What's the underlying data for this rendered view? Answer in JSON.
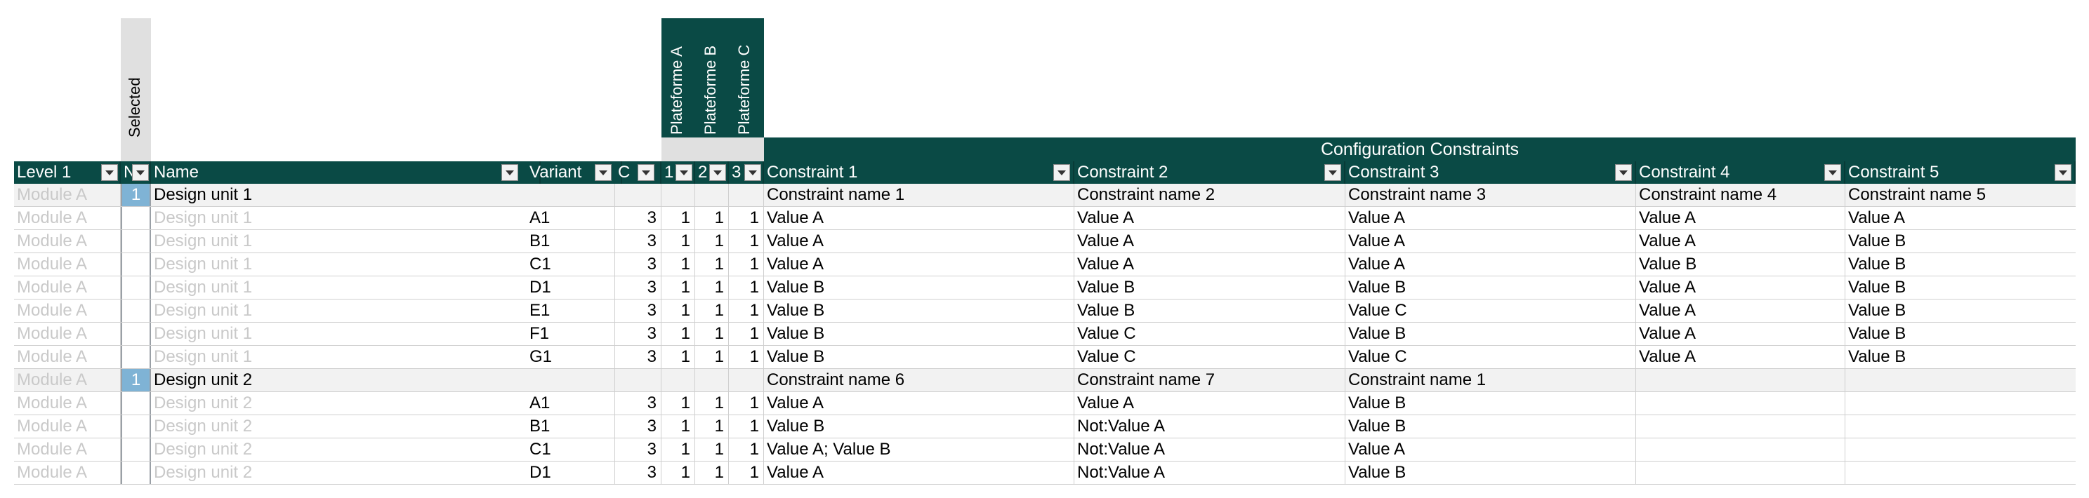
{
  "header": {
    "selected_label": "Selected",
    "platforms": [
      "Plateforme A",
      "Plateforme B",
      "Plateforme C"
    ],
    "config_group": "Configuration Constraints",
    "columns": {
      "level1": "Level 1",
      "n": "N",
      "name": "Name",
      "variant": "Variant",
      "c": "C",
      "p1": "1",
      "p2": "2",
      "p3": "3",
      "cons1": "Constraint 1",
      "cons2": "Constraint 2",
      "cons3": "Constraint 3",
      "cons4": "Constraint 4",
      "cons5": "Constraint 5"
    }
  },
  "rows": [
    {
      "type": "group",
      "level": "Module A",
      "sel": "1",
      "name": "Design unit 1",
      "variant": "",
      "c": "",
      "p1": "",
      "p2": "",
      "p3": "",
      "c1": "Constraint name 1",
      "c2": "Constraint name 2",
      "c3": "Constraint name 3",
      "c4": "Constraint name 4",
      "c5": "Constraint name 5"
    },
    {
      "type": "item",
      "level": "Module A",
      "sel": "",
      "name": "Design unit 1",
      "variant": "A1",
      "c": "3",
      "p1": "1",
      "p2": "1",
      "p3": "1",
      "c1": "Value A",
      "c2": "Value A",
      "c3": "Value A",
      "c4": "Value A",
      "c5": "Value A"
    },
    {
      "type": "item",
      "level": "Module A",
      "sel": "",
      "name": "Design unit 1",
      "variant": "B1",
      "c": "3",
      "p1": "1",
      "p2": "1",
      "p3": "1",
      "c1": "Value A",
      "c2": "Value A",
      "c3": "Value A",
      "c4": "Value A",
      "c5": "Value B"
    },
    {
      "type": "item",
      "level": "Module A",
      "sel": "",
      "name": "Design unit 1",
      "variant": "C1",
      "c": "3",
      "p1": "1",
      "p2": "1",
      "p3": "1",
      "c1": "Value A",
      "c2": "Value A",
      "c3": "Value A",
      "c4": "Value B",
      "c5": "Value B"
    },
    {
      "type": "item",
      "level": "Module A",
      "sel": "",
      "name": "Design unit 1",
      "variant": "D1",
      "c": "3",
      "p1": "1",
      "p2": "1",
      "p3": "1",
      "c1": "Value B",
      "c2": "Value B",
      "c3": "Value B",
      "c4": "Value A",
      "c5": "Value B"
    },
    {
      "type": "item",
      "level": "Module A",
      "sel": "",
      "name": "Design unit 1",
      "variant": "E1",
      "c": "3",
      "p1": "1",
      "p2": "1",
      "p3": "1",
      "c1": "Value B",
      "c2": "Value B",
      "c3": "Value C",
      "c4": "Value A",
      "c5": "Value B"
    },
    {
      "type": "item",
      "level": "Module A",
      "sel": "",
      "name": "Design unit 1",
      "variant": "F1",
      "c": "3",
      "p1": "1",
      "p2": "1",
      "p3": "1",
      "c1": "Value B",
      "c2": "Value C",
      "c3": "Value B",
      "c4": "Value A",
      "c5": "Value B"
    },
    {
      "type": "item",
      "level": "Module A",
      "sel": "",
      "name": "Design unit 1",
      "variant": "G1",
      "c": "3",
      "p1": "1",
      "p2": "1",
      "p3": "1",
      "c1": "Value B",
      "c2": "Value C",
      "c3": "Value C",
      "c4": "Value A",
      "c5": "Value B"
    },
    {
      "type": "group",
      "level": "Module A",
      "sel": "1",
      "name": "Design unit 2",
      "variant": "",
      "c": "",
      "p1": "",
      "p2": "",
      "p3": "",
      "c1": "Constraint name 6",
      "c2": "Constraint name 7",
      "c3": "Constraint name 1",
      "c4": "",
      "c5": ""
    },
    {
      "type": "item",
      "level": "Module A",
      "sel": "",
      "name": "Design unit 2",
      "variant": "A1",
      "c": "3",
      "p1": "1",
      "p2": "1",
      "p3": "1",
      "c1": "Value A",
      "c2": "Value A",
      "c3": "Value B",
      "c4": "",
      "c5": ""
    },
    {
      "type": "item",
      "level": "Module A",
      "sel": "",
      "name": "Design unit 2",
      "variant": "B1",
      "c": "3",
      "p1": "1",
      "p2": "1",
      "p3": "1",
      "c1": "Value B",
      "c2": "Not:Value A",
      "c3": "Value B",
      "c4": "",
      "c5": ""
    },
    {
      "type": "item",
      "level": "Module A",
      "sel": "",
      "name": "Design unit 2",
      "variant": "C1",
      "c": "3",
      "p1": "1",
      "p2": "1",
      "p3": "1",
      "c1": "Value A; Value B",
      "c2": "Not:Value A",
      "c3": "Value A",
      "c4": "",
      "c5": ""
    },
    {
      "type": "item",
      "level": "Module A",
      "sel": "",
      "name": "Design unit 2",
      "variant": "D1",
      "c": "3",
      "p1": "1",
      "p2": "1",
      "p3": "1",
      "c1": "Value A",
      "c2": "Not:Value A",
      "c3": "Value B",
      "c4": "",
      "c5": ""
    }
  ]
}
